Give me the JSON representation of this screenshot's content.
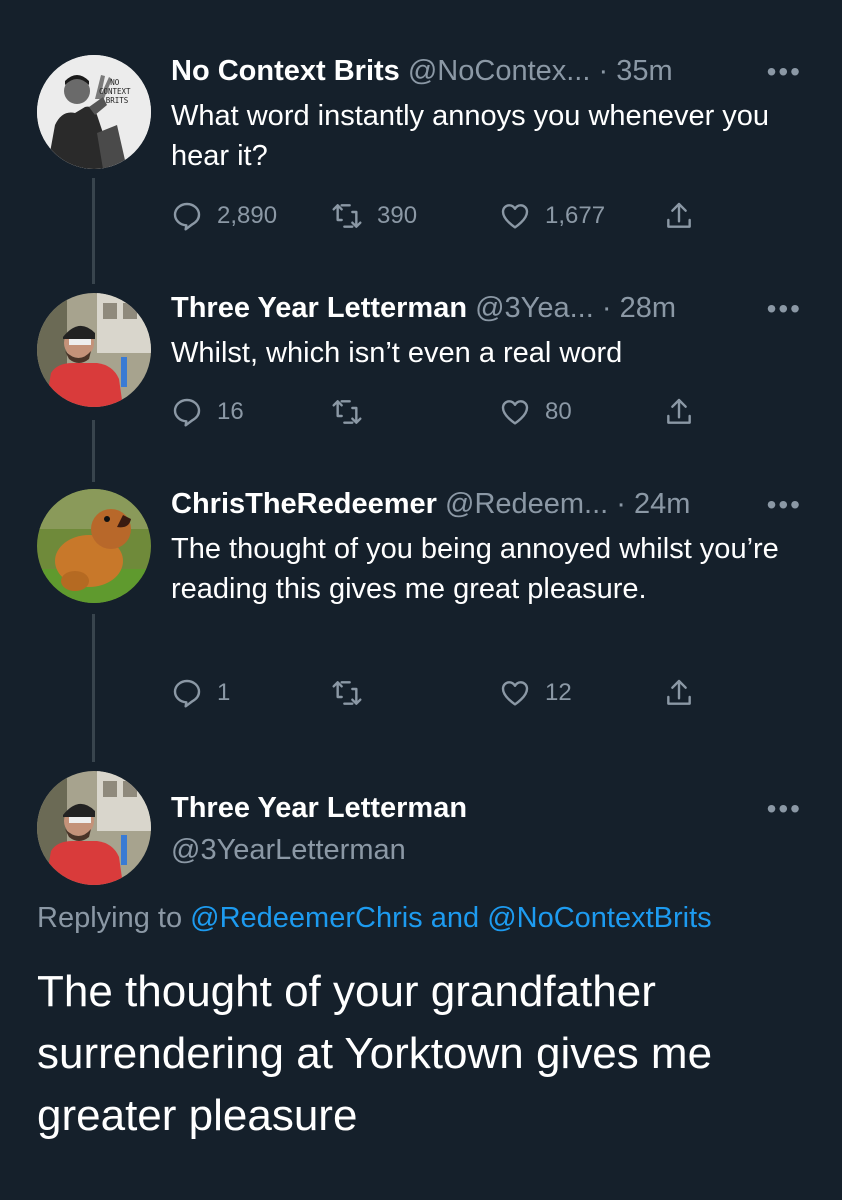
{
  "tweets": [
    {
      "name": "No Context Brits",
      "handle": "@NoContex...",
      "time": "· 35m",
      "text": "What word instantly annoys you whenever you hear it?",
      "replies": "2,890",
      "retweets": "390",
      "likes": "1,677",
      "avatar_text": [
        "NO",
        "CONTEXT",
        "BRITS"
      ]
    },
    {
      "name": "Three Year Letterman",
      "handle": "@3Yea...",
      "time": "· 28m",
      "text": "Whilst, which isn’t even a real word",
      "replies": "16",
      "retweets": "",
      "likes": "80"
    },
    {
      "name": "ChrisTheRedeemer",
      "handle": "@Redeem...",
      "time": "· 24m",
      "text": "The thought of you being annoyed whilst you’re reading this gives me great pleasure.",
      "replies": "1",
      "retweets": "",
      "likes": "12"
    }
  ],
  "main_tweet": {
    "name": "Three Year Letterman",
    "handle": "@3YearLetterman",
    "replying_prefix": "Replying to",
    "mention_1": "@RedeemerChris",
    "and": "and",
    "mention_2": "@NoContextBrits",
    "text": "The thought of your grandfather surrendering at Yorktown gives me greater pleasure"
  },
  "more_label": "•••",
  "colors": {
    "background": "#15202b",
    "secondary_text": "#8b98a5",
    "link": "#1d9bf0",
    "thread_line": "#38444d"
  },
  "icons": [
    "reply-icon",
    "retweet-icon",
    "like-icon",
    "share-icon",
    "more-icon"
  ]
}
